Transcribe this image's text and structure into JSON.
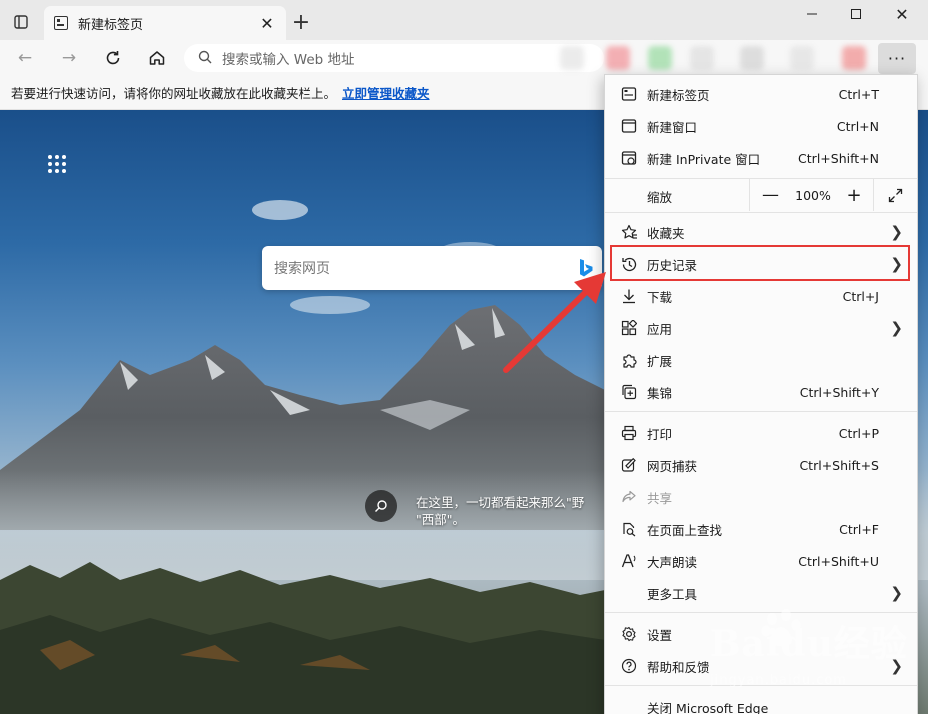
{
  "browser": {
    "tab_title": "新建标签页",
    "address_placeholder": "搜索或输入 Web 地址"
  },
  "favorites_bar": {
    "message": "若要进行快速访问，请将你的网址收藏放在此收藏夹栏上。",
    "link": "立即管理收藏夹"
  },
  "newtab": {
    "search_placeholder": "搜索网页",
    "caption": "在这里，一切都看起来那么\"野\n\"西部\"。"
  },
  "menu": {
    "items": [
      {
        "label": "新建标签页",
        "shortcut": "Ctrl+T",
        "icon": "new-tab-icon"
      },
      {
        "label": "新建窗口",
        "shortcut": "Ctrl+N",
        "icon": "new-window-icon"
      },
      {
        "label": "新建 InPrivate 窗口",
        "shortcut": "Ctrl+Shift+N",
        "icon": "inprivate-icon"
      },
      {
        "label": "缩放",
        "zoom_value": "100%"
      },
      {
        "label": "收藏夹",
        "icon": "favorites-star-icon"
      },
      {
        "label": "历史记录",
        "icon": "history-icon"
      },
      {
        "label": "下载",
        "shortcut": "Ctrl+J",
        "icon": "download-icon"
      },
      {
        "label": "应用",
        "icon": "apps-icon"
      },
      {
        "label": "扩展",
        "icon": "extensions-icon"
      },
      {
        "label": "集锦",
        "shortcut": "Ctrl+Shift+Y",
        "icon": "collections-icon"
      },
      {
        "label": "打印",
        "shortcut": "Ctrl+P",
        "icon": "print-icon"
      },
      {
        "label": "网页捕获",
        "shortcut": "Ctrl+Shift+S",
        "icon": "web-capture-icon"
      },
      {
        "label": "共享",
        "icon": "share-icon"
      },
      {
        "label": "在页面上查找",
        "shortcut": "Ctrl+F",
        "icon": "find-icon"
      },
      {
        "label": "大声朗读",
        "shortcut": "Ctrl+Shift+U",
        "icon": "read-aloud-icon"
      },
      {
        "label": "更多工具"
      },
      {
        "label": "设置",
        "icon": "settings-icon"
      },
      {
        "label": "帮助和反馈",
        "icon": "help-icon"
      },
      {
        "label": "关闭 Microsoft Edge"
      }
    ]
  },
  "watermark": {
    "main": "Baidu经验",
    "sub": "jingyan.baidu.com"
  },
  "colors": {
    "highlight": "#e53935",
    "link": "#0b57c9"
  }
}
